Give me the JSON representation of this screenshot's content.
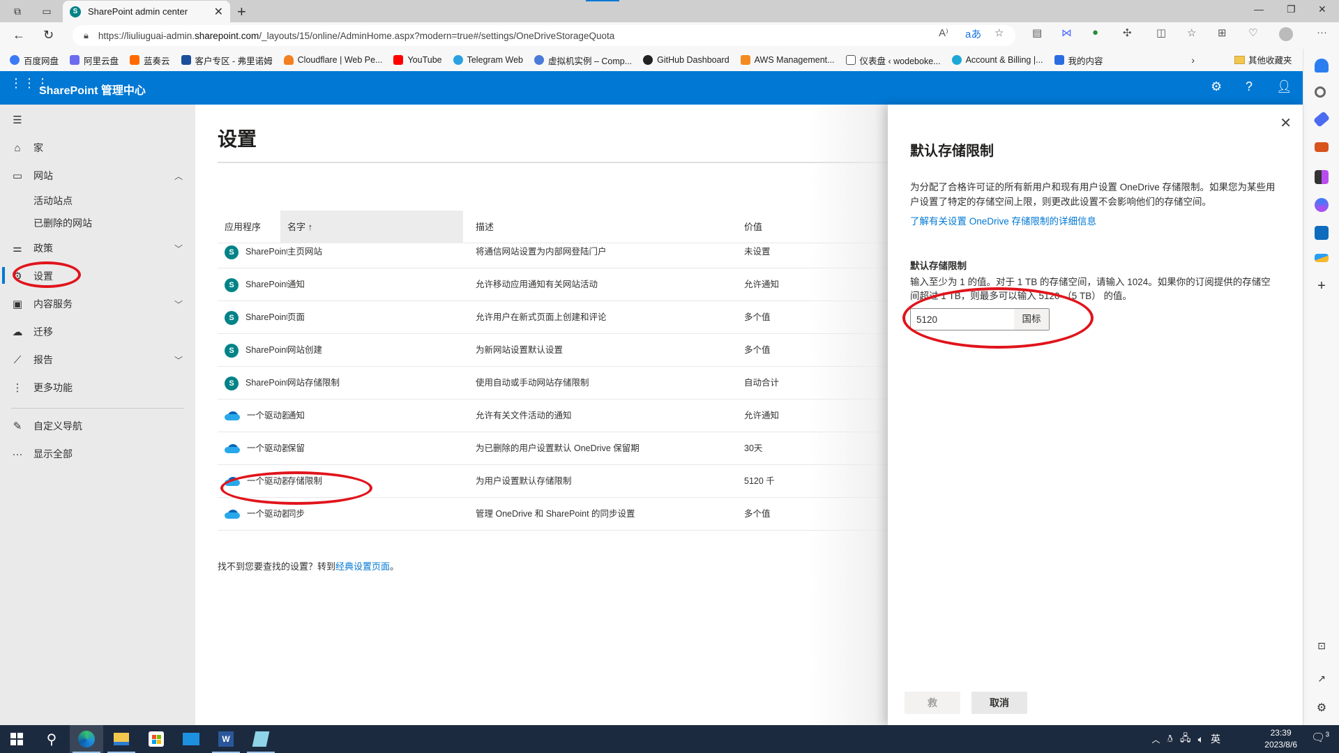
{
  "browser": {
    "tab_title": "SharePoint admin center",
    "url_prefix": "https://liuliuguai-admin.",
    "url_domain": "sharepoint.com",
    "url_rest": "/_layouts/15/online/AdminHome.aspx?modern=true#/settings/OneDriveStorageQuota",
    "bookmarks": [
      {
        "label": "百度网盘",
        "color": "#3a7bf5"
      },
      {
        "label": "阿里云盘",
        "color": "#6b6bf0"
      },
      {
        "label": "蓝奏云",
        "color": "#ff6a00"
      },
      {
        "label": "客户专区 - 弗里诺姆",
        "color": "#1b4f9c"
      },
      {
        "label": "Cloudflare | Web Pe...",
        "color": "#f38020"
      },
      {
        "label": "YouTube",
        "color": "#ff0000"
      },
      {
        "label": "Telegram Web",
        "color": "#2aa1e0"
      },
      {
        "label": "虚拟机实例 – Comp...",
        "color": "#4a7bd8"
      },
      {
        "label": "GitHub Dashboard",
        "color": "#222222"
      },
      {
        "label": "AWS Management...",
        "color": "#f58b1f"
      },
      {
        "label": "仪表盘 ‹ wodeboke...",
        "color": "#888888"
      },
      {
        "label": "Account & Billing |...",
        "color": "#1ea7d6"
      },
      {
        "label": "我的内容",
        "color": "#2b6de0"
      }
    ],
    "other_bookmarks": "其他收藏夹"
  },
  "header": {
    "app_title": "SharePoint 管理中心",
    "brand_color": "#0078d4"
  },
  "nav": {
    "items": [
      {
        "label": "家",
        "icon": "home-icon"
      },
      {
        "label": "网站",
        "icon": "browser-window-icon",
        "expanded": true
      },
      {
        "label": "活动站点",
        "sub": true
      },
      {
        "label": "已删除的网站",
        "sub": true
      },
      {
        "label": "政策",
        "icon": "sliders-icon"
      },
      {
        "label": "设置",
        "icon": "gear-icon",
        "selected": true
      },
      {
        "label": "内容服务",
        "icon": "content-services-icon"
      },
      {
        "label": "迁移",
        "icon": "cloud-upload-icon"
      },
      {
        "label": "报告",
        "icon": "chart-icon"
      },
      {
        "label": "更多功能",
        "icon": "more-vertical-icon"
      },
      {
        "label": "自定义导航",
        "icon": "pencil-icon"
      },
      {
        "label": "显示全部",
        "icon": "ellipsis-icon"
      }
    ]
  },
  "main": {
    "title": "设置",
    "columns": [
      "应用程序",
      "名字 ↑",
      "描述",
      "价值"
    ],
    "rows": [
      {
        "app": "SharePoint",
        "type": "sp",
        "name": "主页网站",
        "desc": "将通信网站设置为内部网登陆门户",
        "value": "未设置"
      },
      {
        "app": "SharePoint",
        "type": "sp",
        "name": "通知",
        "desc": "允许移动应用通知有关网站活动",
        "value": "允许通知"
      },
      {
        "app": "SharePoint",
        "type": "sp",
        "name": "页面",
        "desc": "允许用户在新式页面上创建和评论",
        "value": "多个值"
      },
      {
        "app": "SharePoint",
        "type": "sp",
        "name": "网站创建",
        "desc": "为新网站设置默认设置",
        "value": "多个值"
      },
      {
        "app": "SharePoint",
        "type": "sp",
        "name": "网站存储限制",
        "desc": "使用自动或手动网站存储限制",
        "value": "自动合计"
      },
      {
        "app": "一个驱动器",
        "type": "od",
        "name": "通知",
        "desc": "允许有关文件活动的通知",
        "value": "允许通知"
      },
      {
        "app": "一个驱动器",
        "type": "od",
        "name": "保留",
        "desc": "为已删除的用户设置默认 OneDrive 保留期",
        "value": "30天"
      },
      {
        "app": "一个驱动器",
        "type": "od",
        "name": "存储限制",
        "desc": "为用户设置默认存储限制",
        "value": "5120 千"
      },
      {
        "app": "一个驱动器",
        "type": "od",
        "name": "同步",
        "desc": "管理 OneDrive 和 SharePoint 的同步设置",
        "value": "多个值"
      }
    ],
    "footnote_text": "找不到您要查找的设置？转到",
    "footnote_link": "经典设置页面",
    "footnote_end": "。"
  },
  "panel": {
    "title": "默认存储限制",
    "description": "为分配了合格许可证的所有新用户和现有用户设置 OneDrive 存储限制。如果您为某些用户设置了特定的存储空间上限，则更改此设置不会影响他们的存储空间。",
    "learn_more_link": "了解有关设置 OneDrive 存储限制的详细信息",
    "field_label": "默认存储限制",
    "field_hint": "输入至少为 1 的值。对于 1 TB 的存储空间，请输入 1024。如果你的订阅提供的存储空间超过 1 TB，则最多可以输入 5120 （5 TB） 的值。",
    "field_value": "5120",
    "field_unit": "国标",
    "save_label": "救",
    "cancel_label": "取消"
  },
  "taskbar": {
    "ime": "英",
    "time": "23:39",
    "date": "2023/8/6",
    "notification_count": "3"
  }
}
